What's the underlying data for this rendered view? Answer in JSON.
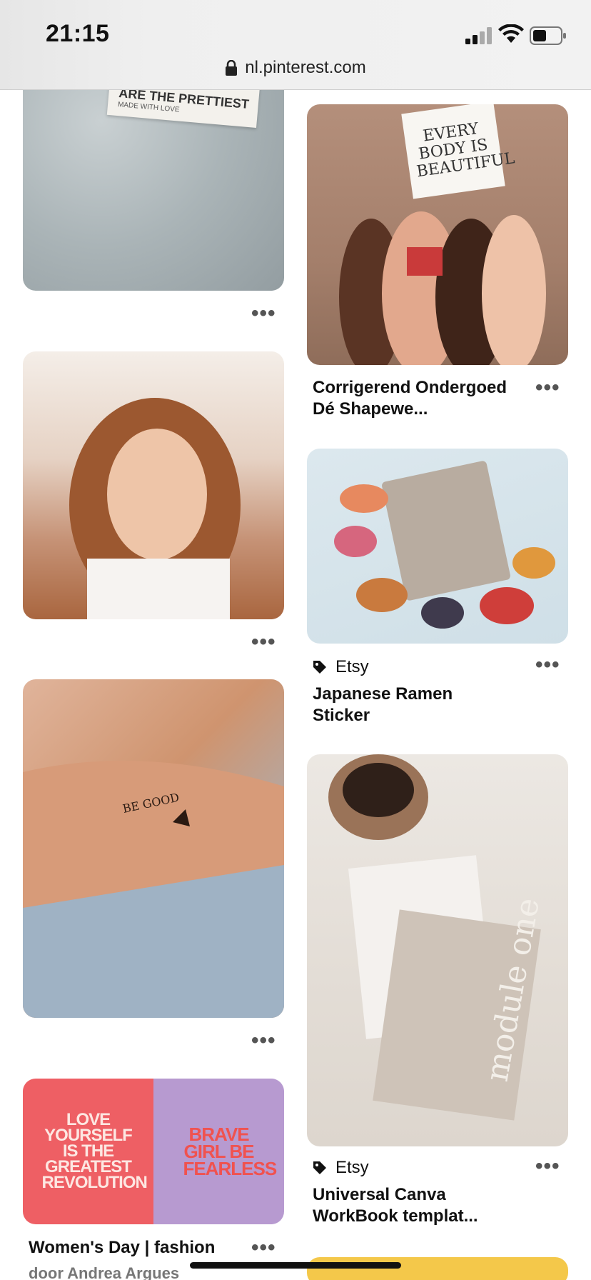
{
  "status": {
    "time": "21:15"
  },
  "browser": {
    "url": "nl.pinterest.com"
  },
  "pins": {
    "denim": {
      "label_text": "ARE THE PRETTIEST",
      "label_sub": "MADE WITH LOVE"
    },
    "quotes": {
      "left": "LOVE YOURSELF IS THE GREATEST REVOLUTION",
      "right": "BRAVE GIRL BE FEARLESS"
    },
    "womens_day": {
      "title": "Women's Day | fashion",
      "subtitle": "door Andrea Argues"
    },
    "shapewear": {
      "title_line1": "Corrigerend Ondergoed",
      "title_line2": "Dé Shapewe...",
      "sign": "EVERY BODY IS BEAUTIFUL"
    },
    "ramen": {
      "store": "Etsy",
      "title_line1": "Japanese Ramen",
      "title_line2": "Sticker"
    },
    "canva": {
      "store": "Etsy",
      "title_line1": "Universal Canva",
      "title_line2": "WorkBook templat...",
      "overlay": "module one"
    }
  },
  "more_glyph": "•••"
}
